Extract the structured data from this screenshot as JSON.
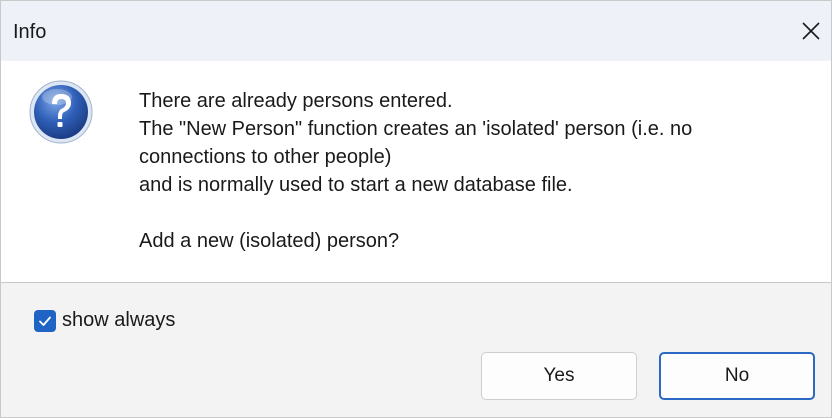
{
  "window": {
    "title": "Info",
    "accent_color": "#1f63c4"
  },
  "titlebar": {
    "close_icon": "close-icon"
  },
  "message": {
    "icon": "question-icon",
    "lines": [
      "There are already persons entered.",
      "The \"New Person\" function creates an 'isolated' person (i.e. no",
      "connections to other people)",
      "and is normally used to start a new database file.",
      "Add a new (isolated) person?"
    ]
  },
  "footer": {
    "checkbox": {
      "label": "show always",
      "checked": true
    },
    "buttons": {
      "yes": "Yes",
      "no": "No"
    }
  }
}
